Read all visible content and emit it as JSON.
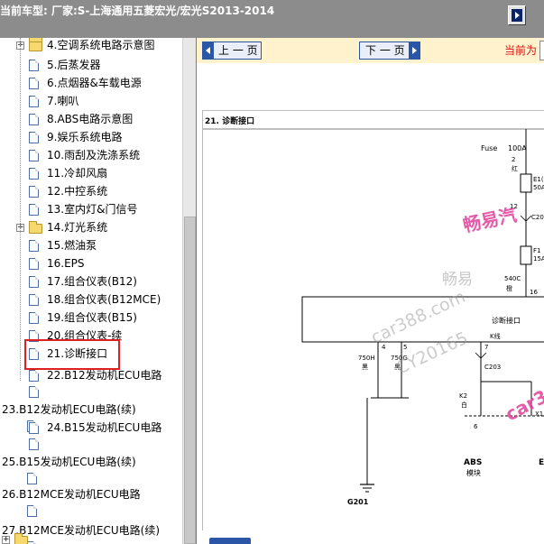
{
  "header": {
    "vehicle_label": "当前车型:   厂家:S-上海通用五菱宏光/宏光S2013-2014",
    "exit_icon": "exit-arrow-icon"
  },
  "tree": {
    "items": [
      {
        "label": "4.空调系统电路示意图",
        "icon": "folder-icon",
        "expander": "+"
      },
      {
        "label": "5.后蒸发器",
        "icon": "document-icon"
      },
      {
        "label": "6.点烟器&车载电源",
        "icon": "document-icon"
      },
      {
        "label": "7.喇叭",
        "icon": "document-icon"
      },
      {
        "label": "8.ABS电路示意图",
        "icon": "document-icon"
      },
      {
        "label": "9.娱乐系统电路",
        "icon": "document-icon"
      },
      {
        "label": "10.雨刮及洗涤系统",
        "icon": "document-icon"
      },
      {
        "label": "11.冷却风扇",
        "icon": "document-icon"
      },
      {
        "label": "12.中控系统",
        "icon": "document-icon"
      },
      {
        "label": "13.室内灯&门信号",
        "icon": "document-icon"
      },
      {
        "label": "14.灯光系统",
        "icon": "folder-icon",
        "expander": "+"
      },
      {
        "label": "15.燃油泵",
        "icon": "document-icon"
      },
      {
        "label": "16.EPS",
        "icon": "document-icon"
      },
      {
        "label": "17.组合仪表(B12)",
        "icon": "document-icon"
      },
      {
        "label": "18.组合仪表(B12MCE)",
        "icon": "document-icon"
      },
      {
        "label": "19.组合仪表(B15)",
        "icon": "document-icon"
      },
      {
        "label": "20.组合仪表-续",
        "icon": "document-icon"
      },
      {
        "label": "21.诊断接口",
        "icon": "document-icon",
        "selected": true
      },
      {
        "label": "22.B12发动机ECU电路",
        "icon": "document-icon"
      },
      {
        "label": "23.B12发动机ECU电路(续)",
        "icon": "document-icon"
      },
      {
        "label": "24.B15发动机ECU电路",
        "icon": "document-icon"
      },
      {
        "label": "25.B15发动机ECU电路(续)",
        "icon": "document-icon"
      },
      {
        "label": "26.B12MCE发动机ECU电路",
        "icon": "document-icon"
      },
      {
        "label": "27.B12MCE发动机ECU电路(续)",
        "icon": "document-icon"
      }
    ],
    "selected_highlight_color": "#e02020"
  },
  "viewer": {
    "prev_button": "上 一 页",
    "next_button": "下 一 页",
    "current_label": "当前为",
    "accent_color": "#2b56a8"
  },
  "diagram": {
    "title": "21.  诊断接口",
    "fuse_label": "Fuse",
    "fuse_rating": "100A",
    "fuse_number": "2",
    "wire_red": "红",
    "e1_label": "E1(",
    "e1_value": "50A",
    "c2_label": "C20",
    "f1_label": "F1",
    "f1_value": "15A",
    "wire_540c": "540C",
    "wire_orange": "橙",
    "pin_16": "16",
    "connector_label": "诊断接口",
    "pin_4": "4",
    "pin_5": "5",
    "pin_7": "7",
    "k_line": "K线",
    "wire_750h": "750H",
    "wire_750g": "750G",
    "wire_black_1": "黑",
    "wire_black_2": "黑",
    "c203": "C203",
    "k2": "K2",
    "wire_white": "白",
    "x1": "X1",
    "pin_6": "6",
    "abs_title": "ABS",
    "abs_sub": "模块",
    "e_partial": "E",
    "ground": "G201"
  },
  "watermarks": {
    "brand_1": "畅易汽",
    "brand_2": "畅易",
    "site_1": "car388.com",
    "site_2": "CY20165",
    "site_3": "car3"
  }
}
